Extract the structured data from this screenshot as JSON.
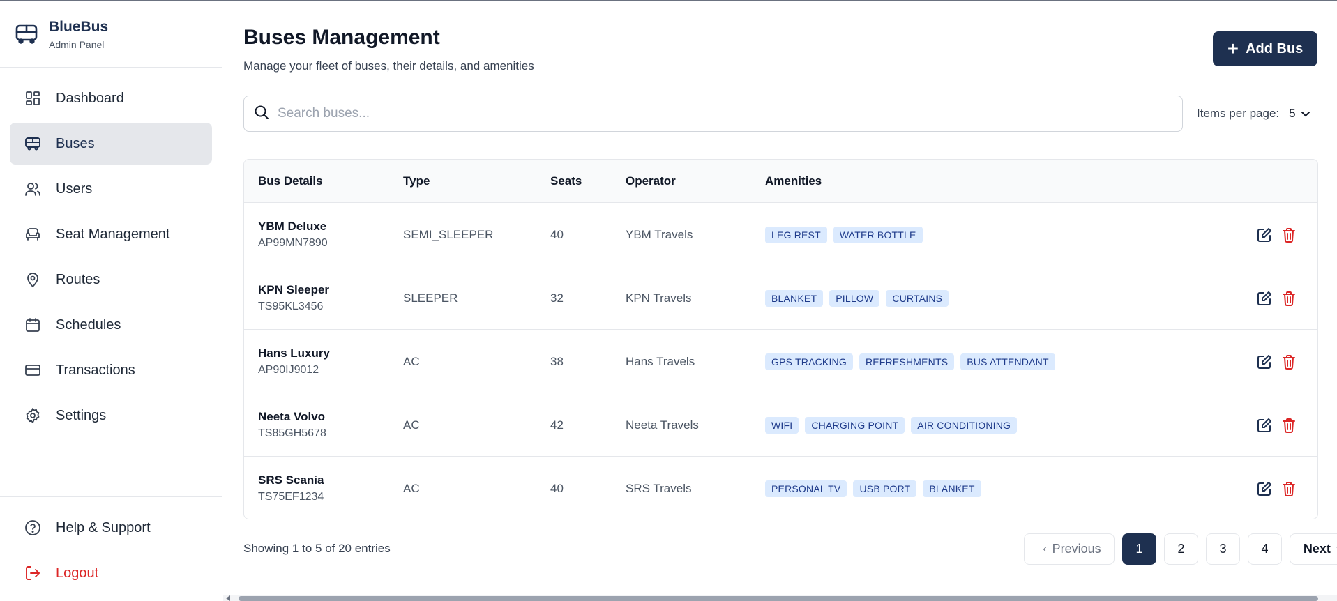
{
  "brand": {
    "name": "BlueBus",
    "subtitle": "Admin Panel"
  },
  "sidebar": {
    "items": [
      {
        "label": "Dashboard",
        "icon": "dashboard-icon",
        "active": false
      },
      {
        "label": "Buses",
        "icon": "bus-icon",
        "active": true
      },
      {
        "label": "Users",
        "icon": "users-icon",
        "active": false
      },
      {
        "label": "Seat Management",
        "icon": "seat-icon",
        "active": false
      },
      {
        "label": "Routes",
        "icon": "map-pin-icon",
        "active": false
      },
      {
        "label": "Schedules",
        "icon": "calendar-icon",
        "active": false
      },
      {
        "label": "Transactions",
        "icon": "credit-card-icon",
        "active": false
      },
      {
        "label": "Settings",
        "icon": "gear-icon",
        "active": false
      }
    ],
    "help_label": "Help & Support",
    "logout_label": "Logout"
  },
  "header": {
    "title": "Buses Management",
    "subtitle": "Manage your fleet of buses, their details, and amenities",
    "add_button": "Add Bus"
  },
  "search": {
    "placeholder": "Search buses...",
    "value": ""
  },
  "items_per_page": {
    "label": "Items per page:",
    "value": "5"
  },
  "table": {
    "headers": [
      "Bus Details",
      "Type",
      "Seats",
      "Operator",
      "Amenities"
    ],
    "rows": [
      {
        "name": "YBM Deluxe",
        "reg": "AP99MN7890",
        "type": "SEMI_SLEEPER",
        "seats": "40",
        "operator": "YBM Travels",
        "amenities": [
          "LEG REST",
          "WATER BOTTLE"
        ]
      },
      {
        "name": "KPN Sleeper",
        "reg": "TS95KL3456",
        "type": "SLEEPER",
        "seats": "32",
        "operator": "KPN Travels",
        "amenities": [
          "BLANKET",
          "PILLOW",
          "CURTAINS"
        ]
      },
      {
        "name": "Hans Luxury",
        "reg": "AP90IJ9012",
        "type": "AC",
        "seats": "38",
        "operator": "Hans Travels",
        "amenities": [
          "GPS TRACKING",
          "REFRESHMENTS",
          "BUS ATTENDANT"
        ]
      },
      {
        "name": "Neeta Volvo",
        "reg": "TS85GH5678",
        "type": "AC",
        "seats": "42",
        "operator": "Neeta Travels",
        "amenities": [
          "WIFI",
          "CHARGING POINT",
          "AIR CONDITIONING"
        ]
      },
      {
        "name": "SRS Scania",
        "reg": "TS75EF1234",
        "type": "AC",
        "seats": "40",
        "operator": "SRS Travels",
        "amenities": [
          "PERSONAL TV",
          "USB PORT",
          "BLANKET"
        ]
      }
    ]
  },
  "pagination": {
    "showing": "Showing 1 to 5 of 20 entries",
    "previous": "Previous",
    "next": "Next",
    "pages": [
      "1",
      "2",
      "3",
      "4"
    ],
    "current": "1"
  },
  "colors": {
    "primary": "#1e3050",
    "danger": "#dc2626",
    "tag_bg": "#dbeafe",
    "tag_text": "#1e3a8a"
  }
}
